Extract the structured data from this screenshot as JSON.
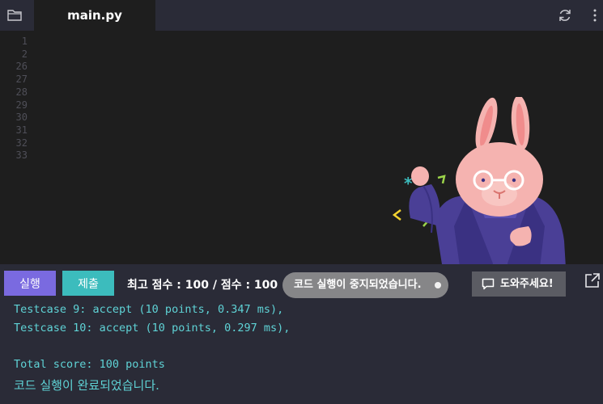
{
  "file_tab": {
    "label": "main.py"
  },
  "editor": {
    "line_numbers": [
      "1",
      "2",
      "26",
      "27",
      "28",
      "29",
      "30",
      "31",
      "32",
      "33"
    ]
  },
  "toolbar": {
    "run_label": "실행",
    "submit_label": "제출",
    "score_text": "최고 점수 : 100 / 점수 : 100"
  },
  "toast": {
    "message": "코드 실행이 중지되었습니다."
  },
  "help": {
    "label": "도와주세요!"
  },
  "console": {
    "lines": [
      "Testcase 9: accept (10 points, 0.347 ms),",
      "Testcase 10: accept (10 points, 0.297 ms),",
      "",
      "Total score: 100 points",
      "코드 실행이 완료되었습니다."
    ]
  },
  "colors": {
    "run_button": "#7a6ae0",
    "submit_button": "#3cbcbd",
    "console_text": "#5fd3d6",
    "toast_bg": "#868688"
  }
}
